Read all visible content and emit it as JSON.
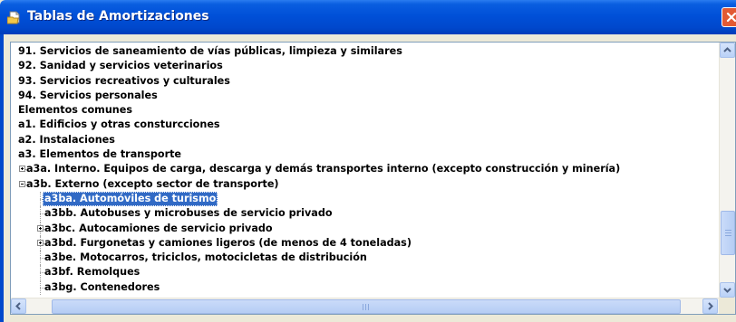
{
  "window": {
    "title": "Tablas de Amortizaciones"
  },
  "tree": {
    "items": [
      {
        "label": "91. Servicios de saneamiento de vías públicas, limpieza y similares",
        "level": 0
      },
      {
        "label": "92. Sanidad y servicios veterinarios",
        "level": 0
      },
      {
        "label": "93. Servicios recreativos y culturales",
        "level": 0
      },
      {
        "label": "94. Servicios personales",
        "level": 0
      },
      {
        "label": "Elementos comunes",
        "level": 0
      },
      {
        "label": "a1. Edificios y otras consturcciones",
        "level": 0
      },
      {
        "label": "a2. Instalaciones",
        "level": 0
      },
      {
        "label": "a3. Elementos de transporte",
        "level": 0
      },
      {
        "label": "a3a. Interno. Equipos de carga, descarga y demás transportes interno (excepto construcción y minería)",
        "level": 1,
        "expander": "plus"
      },
      {
        "label": "a3b. Externo (excepto sector de transporte)",
        "level": 1,
        "expander": "minus"
      },
      {
        "label": "a3ba. Automóviles de turismo",
        "level": 2,
        "selected": true
      },
      {
        "label": "a3bb. Autobuses y microbuses de servicio privado",
        "level": 2
      },
      {
        "label": "a3bc. Autocamiones de servicio privado",
        "level": 2,
        "expander": "plus"
      },
      {
        "label": "a3bd. Furgonetas y camiones ligeros (de menos de 4 toneladas)",
        "level": 2,
        "expander": "plus"
      },
      {
        "label": "a3be. Motocarros, triciclos, motocicletas de distribución",
        "level": 2
      },
      {
        "label": "a3bf. Remolques",
        "level": 2
      },
      {
        "label": "a3bg. Contenedores",
        "level": 2
      }
    ]
  },
  "icons": {
    "title": "folder-document-icon",
    "close": "close-icon"
  },
  "colors": {
    "titlebar": "#0050d8",
    "selection": "#316ac5",
    "close_button": "#e25a34"
  }
}
